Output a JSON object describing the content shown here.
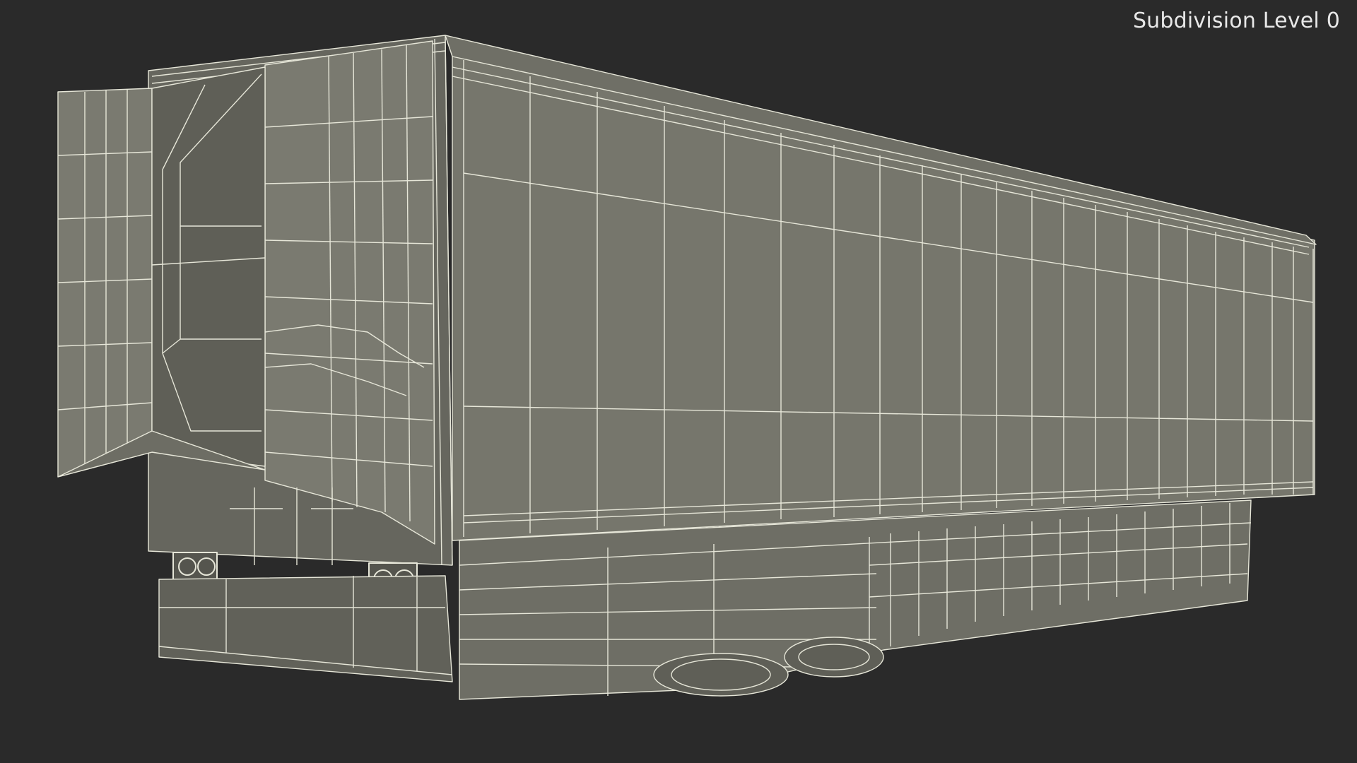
{
  "viewport": {
    "overlay_label": "Subdivision Level 0"
  },
  "model": {
    "subject": "semi-trailer-wireframe",
    "colors": {
      "background": "#2a2a2a",
      "surface": "#76766c",
      "surface_dark": "#5f5f57",
      "wire": "#e6e6d8"
    }
  }
}
